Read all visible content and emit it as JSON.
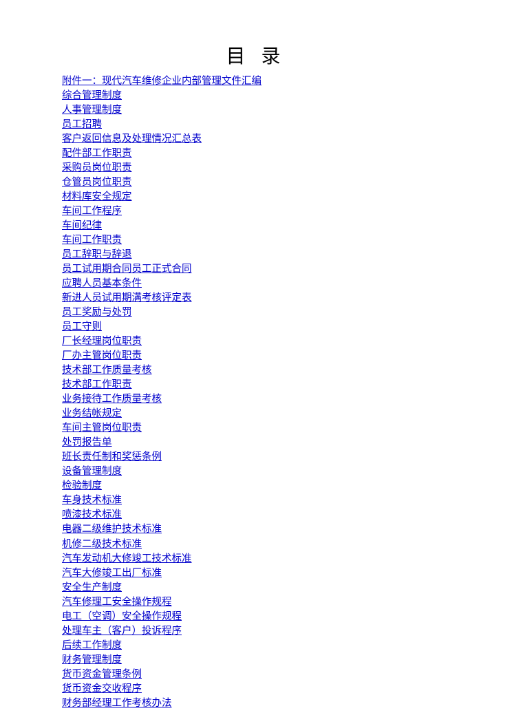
{
  "title": "目 录",
  "toc": [
    "附件一：现代汽车维修企业内部管理文件汇编",
    "综合管理制度",
    "人事管理制度",
    "员工招聘",
    "客户返回信息及处理情况汇总表",
    "配件部工作职责",
    "采购员岗位职责",
    "仓管员岗位职责",
    "材料库安全规定",
    "车间工作程序",
    "车间纪律",
    "车间工作职责",
    "员工辞职与辞退",
    "员工试用期合同员工正式合同",
    "应聘人员基本条件",
    "新进人员试用期满考核评定表",
    "员工奖励与处罚",
    "员工守则",
    "厂长经理岗位职责",
    "厂办主管岗位职责",
    "技术部工作质量考核",
    "技术部工作职责",
    "业务接待工作质量考核",
    "业务结帐规定",
    "车间主管岗位职责",
    "处罚报告单",
    "班长责任制和奖惩条例",
    "设备管理制度",
    "检验制度",
    "车身技术标准",
    "喷漆技术标准",
    "电器二级维护技术标准",
    "机修二级技术标准",
    "汽车发动机大修竣工技术标准",
    "汽车大修竣工出厂标准",
    "安全生产制度",
    "汽车修理工安全操作规程",
    "电工（空调）安全操作规程",
    "处理车主（客户）投诉程序",
    "后续工作制度",
    "财务管理制度",
    "货币资金管理条例",
    "货币资金交收程序",
    "财务部经理工作考核办法"
  ]
}
